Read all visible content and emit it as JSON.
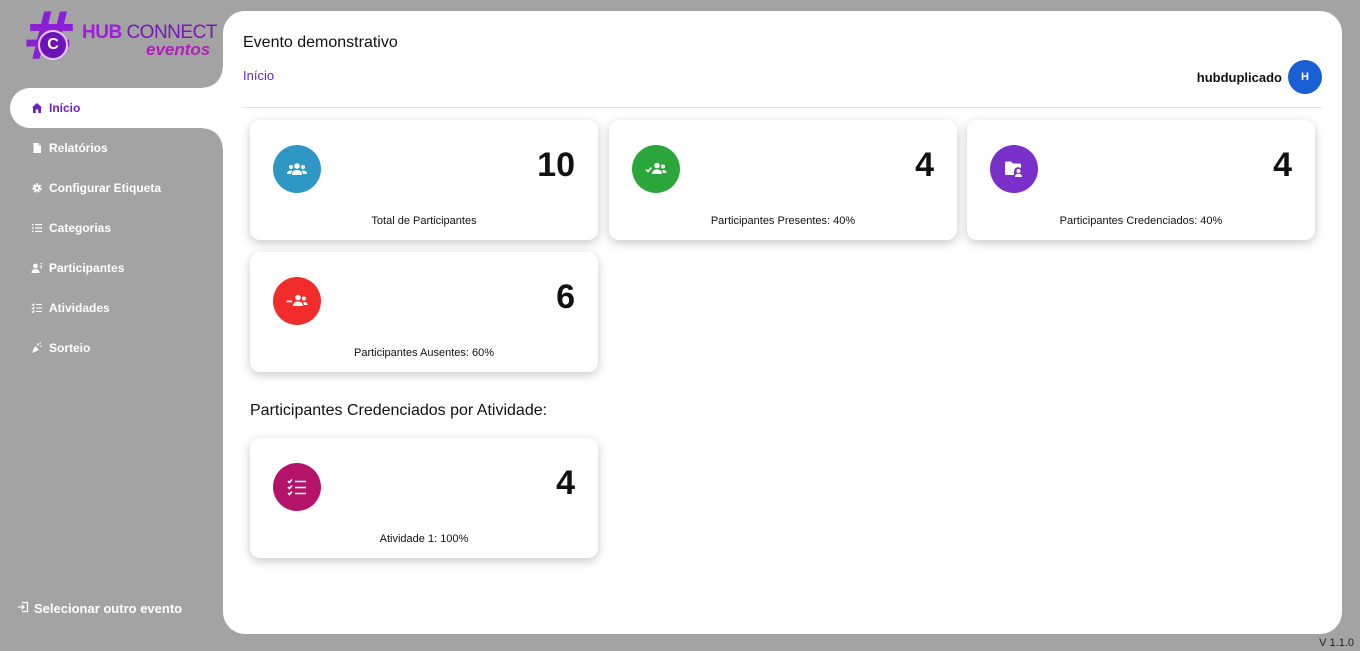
{
  "logo": {
    "brand_bold": "HUB",
    "brand_light": "CONNECT",
    "brand_sub": "eventos"
  },
  "nav": {
    "items": [
      {
        "label": "Início",
        "icon": "home-icon",
        "active": true
      },
      {
        "label": "Relatórios",
        "icon": "document-icon"
      },
      {
        "label": "Configurar Etiqueta",
        "icon": "gear-icon"
      },
      {
        "label": "Categorias",
        "icon": "list-icon"
      },
      {
        "label": "Participantes",
        "icon": "user-icon"
      },
      {
        "label": "Atividades",
        "icon": "checklist-icon"
      },
      {
        "label": "Sorteio",
        "icon": "party-icon"
      }
    ],
    "select_event": "Selecionar outro evento"
  },
  "header": {
    "event_title": "Evento demonstrativo",
    "breadcrumb": "Início",
    "user_name": "hubduplicado",
    "avatar_initial": "H"
  },
  "stats": [
    {
      "value": "10",
      "label": "Total de Participantes",
      "color": "#2f97c4",
      "icon": "group-icon"
    },
    {
      "value": "4",
      "label": "Participantes Presentes: 40%",
      "color": "#2aa63a",
      "icon": "group-check-icon"
    },
    {
      "value": "4",
      "label": "Participantes Credenciados: 40%",
      "color": "#7a2fc8",
      "icon": "badge-folder-icon"
    },
    {
      "value": "6",
      "label": "Participantes Ausentes: 60%",
      "color": "#f22b2b",
      "icon": "group-minus-icon"
    }
  ],
  "activities": {
    "section_title": "Participantes Credenciados por Atividade:",
    "items": [
      {
        "value": "4",
        "label": "Atividade 1: 100%",
        "color": "#b51269",
        "icon": "checklist-icon"
      }
    ]
  },
  "version": "V 1.1.0"
}
